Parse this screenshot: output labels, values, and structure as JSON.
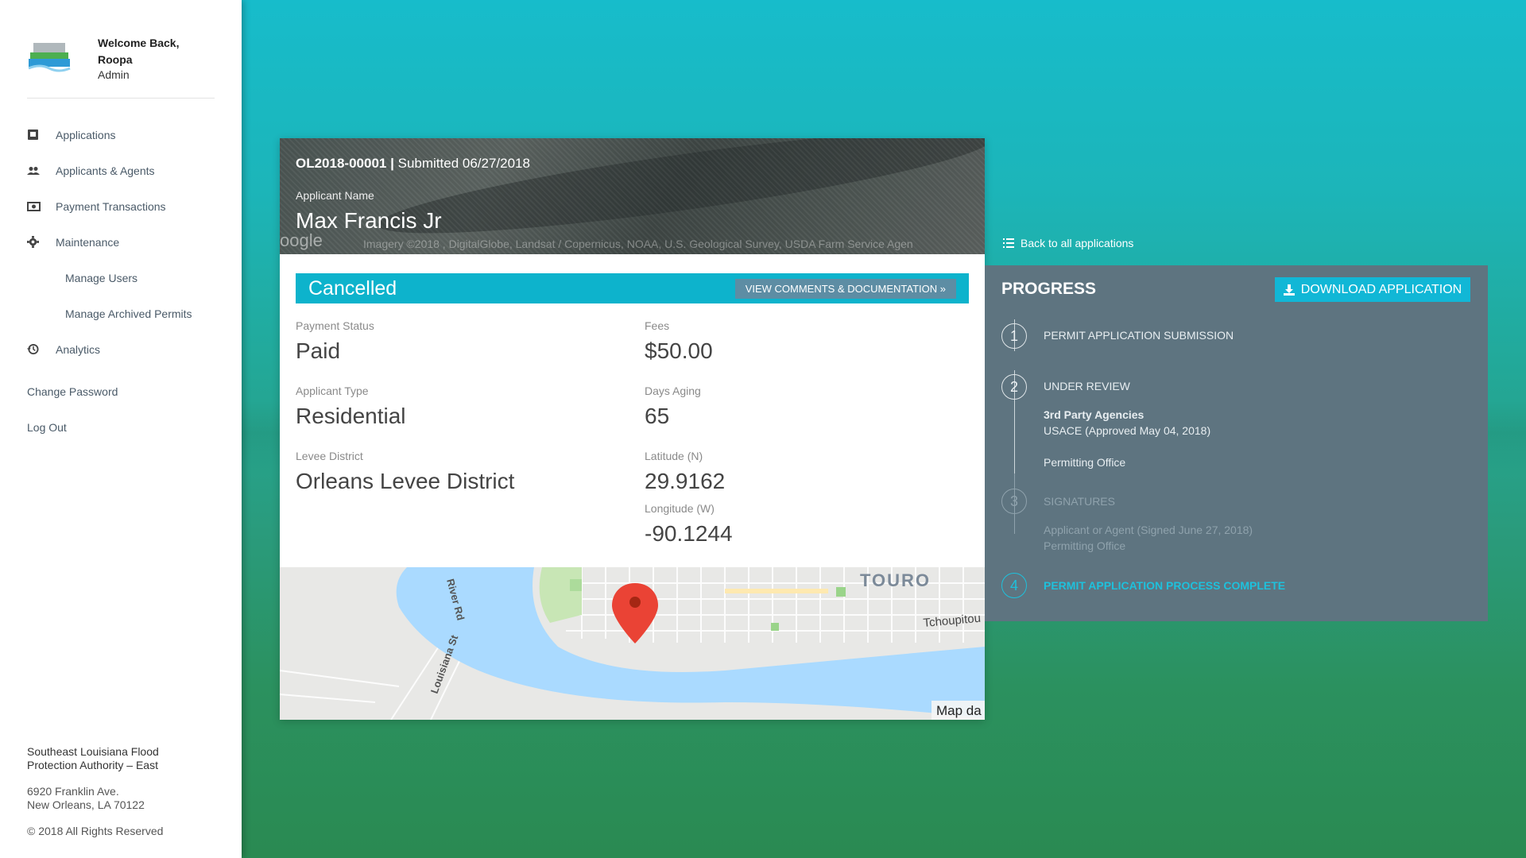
{
  "sidebar": {
    "welcome_line1": "Welcome Back,",
    "welcome_line2": "Roopa",
    "role": "Admin",
    "nav": [
      {
        "label": "Applications",
        "icon": "applications-icon"
      },
      {
        "label": "Applicants & Agents",
        "icon": "users-icon"
      },
      {
        "label": "Payment Transactions",
        "icon": "money-icon"
      },
      {
        "label": "Maintenance",
        "icon": "gear-icon"
      }
    ],
    "sub_nav": [
      "Manage Users",
      "Manage Archived Permits"
    ],
    "analytics": "Analytics",
    "change_password": "Change Password",
    "logout": "Log Out",
    "footer": {
      "org_line1": "Southeast Louisiana Flood",
      "org_line2": "Protection Authority – East",
      "addr_line1": "6920 Franklin Ave.",
      "addr_line2": "New Orleans, LA 70122",
      "copyright": "© 2018 All Rights Reserved"
    }
  },
  "application": {
    "id": "OL2018-00001",
    "separator": "|",
    "submitted": "Submitted 06/27/2018",
    "name_label": "Applicant Name",
    "name": "Max Francis Jr",
    "imagery_credit": "Imagery ©2018 , DigitalGlobe, Landsat / Copernicus, NOAA, U.S. Geological Survey, USDA Farm Service Agen",
    "google": "oogle",
    "status": "Cancelled",
    "view_button": "VIEW COMMENTS & DOCUMENTATION »",
    "fields": {
      "payment_status_label": "Payment Status",
      "payment_status": "Paid",
      "fees_label": "Fees",
      "fees": "$50.00",
      "applicant_type_label": "Applicant Type",
      "applicant_type": "Residential",
      "days_aging_label": "Days Aging",
      "days_aging": "65",
      "levee_district_label": "Levee District",
      "levee_district": "Orleans Levee District",
      "latitude_label": "Latitude (N)",
      "latitude": "29.9162",
      "longitude_label": "Longitude (W)",
      "longitude": "-90.1244"
    },
    "map": {
      "labels": [
        "River Rd",
        "Louisiana St",
        "TOURO",
        "Tchoupitou"
      ],
      "credit": "Map da"
    }
  },
  "progress": {
    "back_link": "Back to all applications",
    "title": "PROGRESS",
    "download_button": "DOWNLOAD APPLICATION",
    "steps": [
      {
        "num": "1",
        "title": "PERMIT APPLICATION SUBMISSION"
      },
      {
        "num": "2",
        "title": "UNDER REVIEW",
        "sub_title": "3rd Party Agencies",
        "sub1": "USACE (Approved May 04, 2018)",
        "sub2": "Permitting Office"
      },
      {
        "num": "3",
        "title": "SIGNATURES",
        "sub1": "Applicant or Agent (Signed June 27, 2018)",
        "sub2": "Permitting Office"
      },
      {
        "num": "4",
        "title": "PERMIT APPLICATION PROCESS COMPLETE"
      }
    ]
  },
  "colors": {
    "accent": "#0db3cc",
    "progress_panel": "#5e7480",
    "active_step": "#1ec1dc"
  }
}
